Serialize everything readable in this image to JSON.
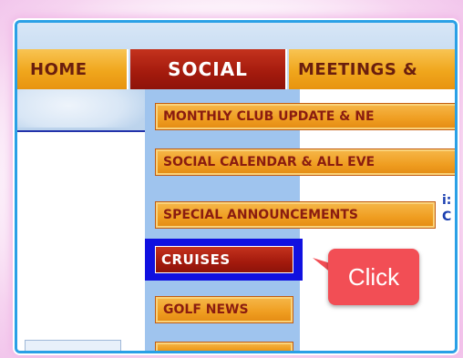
{
  "nav": {
    "home": "HOME",
    "social": "SOCIAL",
    "meetings": "MEETINGS &"
  },
  "dropdown": {
    "items": [
      {
        "label": "MONTHLY CLUB  UPDATE & NE"
      },
      {
        "label": "SOCIAL CALENDAR & ALL EVE"
      },
      {
        "label": "SPECIAL ANNOUNCEMENTS"
      },
      {
        "label": "CRUISES"
      },
      {
        "label": "GOLF NEWS"
      }
    ]
  },
  "side_text": "i: C",
  "callout": {
    "label": "Click"
  },
  "colors": {
    "nav_orange": "#f0a61c",
    "nav_active_red": "#a31a0d",
    "dropdown_bg": "#9fc4ee",
    "highlight_blue": "#1010e0",
    "callout_red": "#f24e55",
    "frame_blue": "#2aa0e6"
  }
}
